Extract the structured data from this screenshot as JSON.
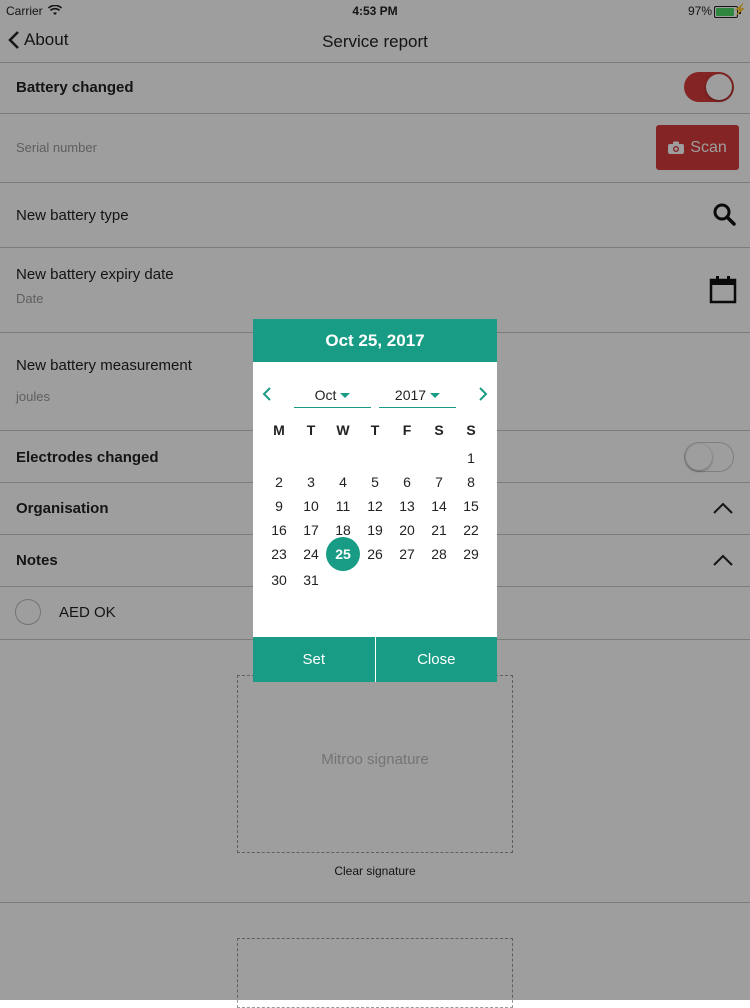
{
  "status_bar": {
    "carrier": "Carrier",
    "time": "4:53 PM",
    "battery": "97%"
  },
  "nav": {
    "back_label": "About",
    "title": "Service report"
  },
  "form": {
    "battery_changed": {
      "label": "Battery changed",
      "on": true
    },
    "serial_number": {
      "placeholder": "Serial number",
      "scan_label": "Scan"
    },
    "battery_type": {
      "label": "New battery type"
    },
    "expiry": {
      "label": "New battery expiry date",
      "placeholder": "Date"
    },
    "measurement": {
      "label": "New battery measurement",
      "placeholder": "joules"
    },
    "electrodes_changed": {
      "label": "Electrodes changed",
      "on": false
    },
    "organisation": {
      "label": "Organisation"
    },
    "notes": {
      "label": "Notes"
    },
    "aed_ok": {
      "label": "AED OK",
      "checked": false
    },
    "signature": {
      "placeholder": "Mitroo signature",
      "clear_label": "Clear signature"
    }
  },
  "date_picker": {
    "header": "Oct 25, 2017",
    "month": "Oct",
    "year": "2017",
    "weekdays": [
      "M",
      "T",
      "W",
      "T",
      "F",
      "S",
      "S"
    ],
    "weeks": [
      [
        "",
        "",
        "",
        "",
        "",
        "",
        "1"
      ],
      [
        "2",
        "3",
        "4",
        "5",
        "6",
        "7",
        "8"
      ],
      [
        "9",
        "10",
        "11",
        "12",
        "13",
        "14",
        "15"
      ],
      [
        "16",
        "17",
        "18",
        "19",
        "20",
        "21",
        "22"
      ],
      [
        "23",
        "24",
        "25",
        "26",
        "27",
        "28",
        "29"
      ],
      [
        "30",
        "31",
        "",
        "",
        "",
        "",
        ""
      ]
    ],
    "selected_day": "25",
    "set_label": "Set",
    "close_label": "Close"
  },
  "colors": {
    "accent": "#199c85",
    "danger": "#d63a3a"
  }
}
